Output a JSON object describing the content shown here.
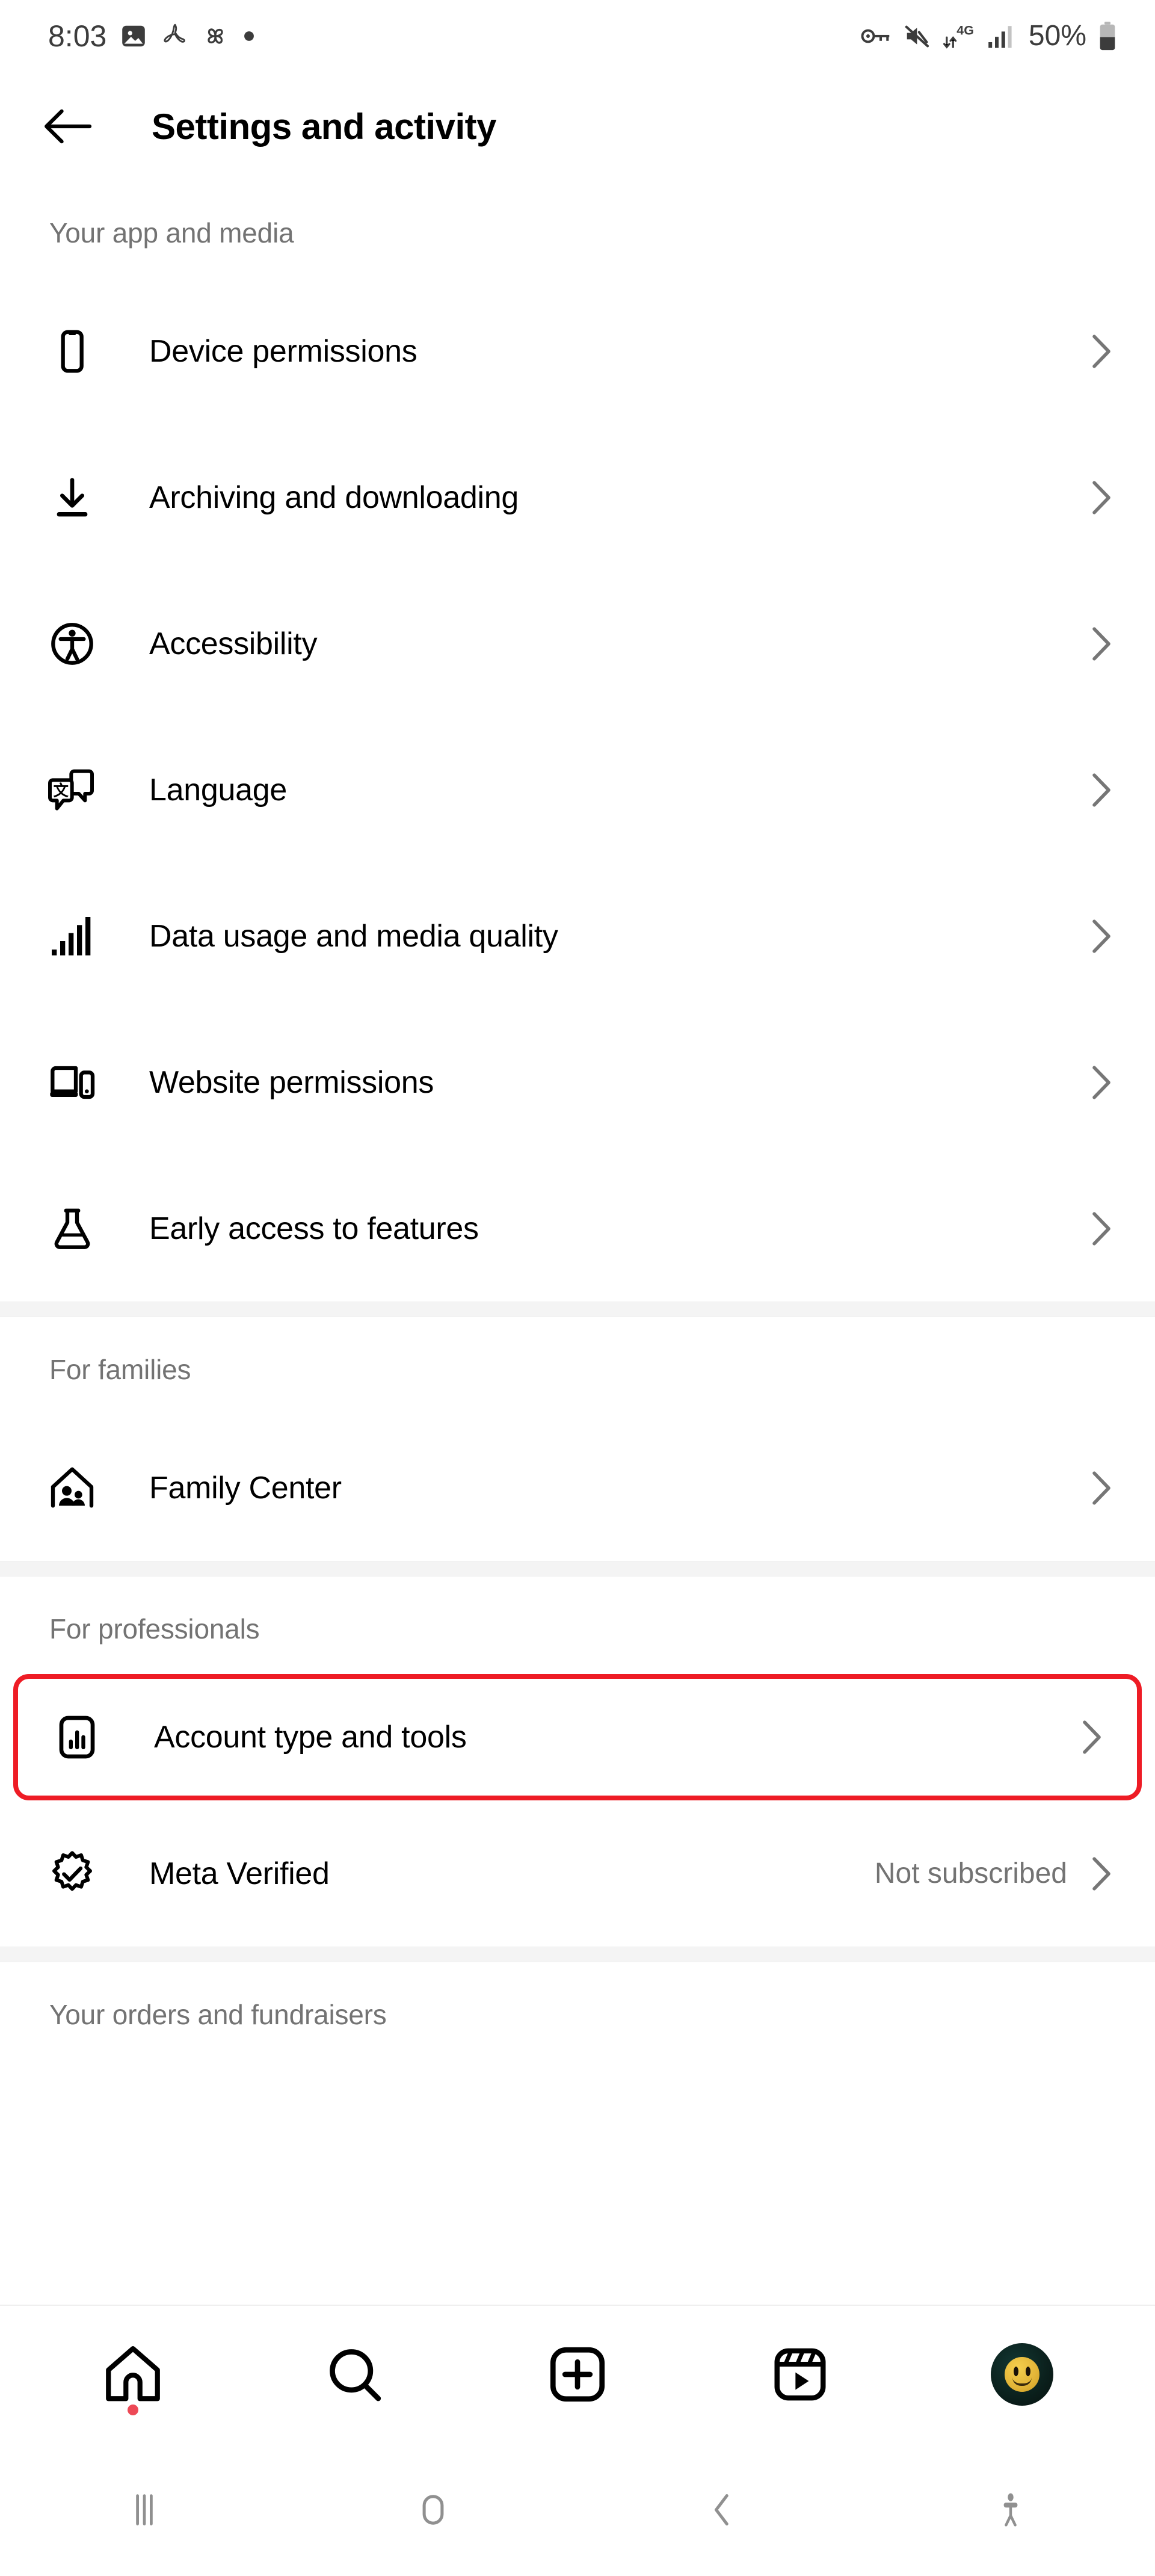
{
  "status_bar": {
    "time": "8:03",
    "battery_percent": "50%",
    "left_icons": [
      "image-icon",
      "adobe-acrobat-icon",
      "pinwheel-icon",
      "dot-icon"
    ],
    "right_icons": [
      "vpn-key-icon",
      "mute-speaker-icon",
      "4g-data-icon",
      "signal-bars-icon",
      "battery-icon"
    ],
    "text_color": "#3c3c3c"
  },
  "header": {
    "back_icon": "arrow-left-icon",
    "title": "Settings and activity"
  },
  "sections": [
    {
      "header": "Your app and media",
      "items": [
        {
          "icon": "phone-icon",
          "label": "Device permissions",
          "value": ""
        },
        {
          "icon": "download-icon",
          "label": "Archiving and downloading",
          "value": ""
        },
        {
          "icon": "accessibility-icon",
          "label": "Accessibility",
          "value": ""
        },
        {
          "icon": "translate-icon",
          "label": "Language",
          "value": ""
        },
        {
          "icon": "signal-bars-icon",
          "label": "Data usage and media quality",
          "value": ""
        },
        {
          "icon": "browser-window-icon",
          "label": "Website permissions",
          "value": ""
        },
        {
          "icon": "flask-icon",
          "label": "Early access to features",
          "value": ""
        }
      ]
    },
    {
      "header": "For families",
      "items": [
        {
          "icon": "family-house-icon",
          "label": "Family Center",
          "value": ""
        }
      ]
    },
    {
      "header": "For professionals",
      "items": [
        {
          "icon": "bar-chart-icon",
          "label": "Account type and tools",
          "value": "",
          "highlighted": true
        },
        {
          "icon": "verified-badge-icon",
          "label": "Meta Verified",
          "value": "Not subscribed"
        }
      ]
    },
    {
      "header": "Your orders and fundraisers",
      "items": []
    }
  ],
  "highlight": {
    "color": "#ee1c25"
  },
  "tabbar": {
    "tabs": [
      {
        "icon": "home-icon",
        "name": "tab-home",
        "badge": true
      },
      {
        "icon": "search-icon",
        "name": "tab-search",
        "badge": false
      },
      {
        "icon": "create-icon",
        "name": "tab-create",
        "badge": false
      },
      {
        "icon": "reels-icon",
        "name": "tab-reels",
        "badge": false
      },
      {
        "icon": "avatar-icon",
        "name": "tab-profile",
        "badge": false
      }
    ],
    "badge_color": "#ed4956"
  },
  "system_nav": {
    "buttons": [
      "recents-icon",
      "home-circle-icon",
      "back-chevron-icon",
      "accessibility-person-icon"
    ],
    "color": "#909090"
  },
  "colors": {
    "section_header_text": "#737373",
    "row_label_text": "#000000",
    "row_value_text": "#737373",
    "divider_band": "#f4f4f4",
    "chevron": "#767676"
  }
}
